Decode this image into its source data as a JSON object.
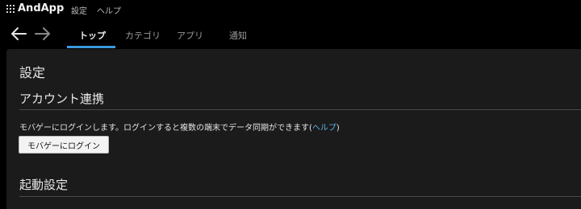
{
  "app": {
    "title": "AndApp"
  },
  "menu": {
    "settings": "設定",
    "help": "ヘルプ"
  },
  "nav": {
    "tabs": [
      {
        "label": "トップ"
      },
      {
        "label": "カテゴリ"
      },
      {
        "label": "アプリ"
      },
      {
        "label": "通知"
      }
    ]
  },
  "colors": {
    "accent": "#3a9be0",
    "link": "#5fb3e8",
    "panel": "#1b1b1b"
  },
  "content": {
    "page_title": "設定",
    "account": {
      "title": "アカウント連携",
      "desc_prefix": "モバゲーにログインします。ログインすると複数の端末でデータ同期ができます(",
      "help_link": "ヘルプ",
      "desc_suffix": ")",
      "login_button": "モバゲーにログイン"
    },
    "startup": {
      "title": "起動設定"
    }
  }
}
